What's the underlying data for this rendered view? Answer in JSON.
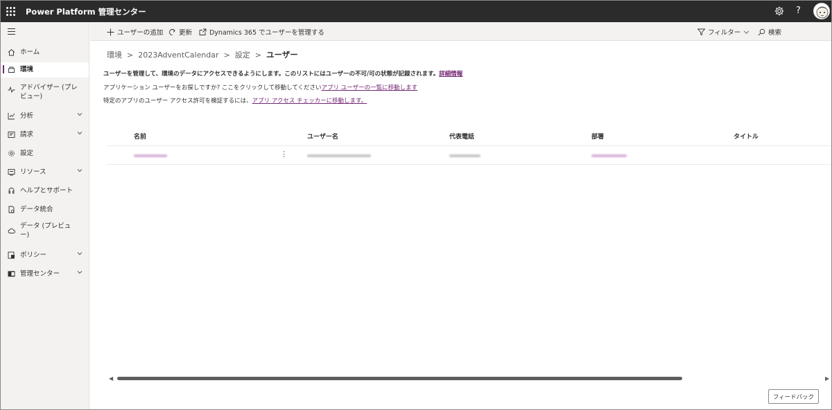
{
  "app": {
    "title": "Power Platform 管理センター"
  },
  "topbar": {
    "settings_icon": "gear-icon",
    "help_label": "?",
    "avatar_icon": "avatar"
  },
  "sidebar": {
    "items": [
      {
        "label": "ホーム",
        "icon": "home-icon",
        "chevron": false,
        "active": false
      },
      {
        "label": "環境",
        "icon": "environment-icon",
        "chevron": false,
        "active": true
      },
      {
        "label": "アドバイザー (プレビュー)",
        "icon": "advisor-icon",
        "chevron": false,
        "active": false
      },
      {
        "label": "分析",
        "icon": "analytics-icon",
        "chevron": true,
        "active": false
      },
      {
        "label": "請求",
        "icon": "billing-icon",
        "chevron": true,
        "active": false
      },
      {
        "label": "設定",
        "icon": "settings-icon",
        "chevron": false,
        "active": false
      },
      {
        "label": "リソース",
        "icon": "resources-icon",
        "chevron": true,
        "active": false
      },
      {
        "label": "ヘルプとサポート",
        "icon": "help-support-icon",
        "chevron": false,
        "active": false
      },
      {
        "label": "データ統合",
        "icon": "data-integration-icon",
        "chevron": false,
        "active": false
      },
      {
        "label": "データ (プレビュー)",
        "icon": "data-preview-icon",
        "chevron": false,
        "active": false
      },
      {
        "label": "ポリシー",
        "icon": "policy-icon",
        "chevron": true,
        "active": false
      },
      {
        "label": "管理センター",
        "icon": "admin-center-icon",
        "chevron": true,
        "active": false
      }
    ]
  },
  "toolbar": {
    "add_user": "ユーザーの追加",
    "refresh": "更新",
    "manage_in_dynamics": "Dynamics 365 でユーザーを管理する",
    "filter": "フィルター",
    "search": "検索"
  },
  "breadcrumb": {
    "environments": "環境",
    "environment_name": "2023AdventCalendar",
    "settings": "設定",
    "current": "ユーザー"
  },
  "info": {
    "line1_text": "ユーザーを管理して、環境のデータにアクセスできるようにします。このリストにはユーザーの不可/可の状態が記録されます。",
    "line1_link": "詳細情報",
    "line2_text": "アプリケーション ユーザーをお探しですか? ここをクリックして移動してください",
    "line2_link": "アプリ ユーザーの一覧に移動します",
    "line3_text": "特定のアプリのユーザー アクセス許可を検証するには、",
    "line3_link": "アプリ アクセス チェッカーに移動します。"
  },
  "table": {
    "columns": [
      "名前",
      "ユーザー名",
      "代表電話",
      "部署",
      "タイトル"
    ],
    "rows_count_note": "",
    "row_more_label": "⋮"
  },
  "footer": {
    "feedback": "フィードバック"
  },
  "colors": {
    "accent": "#742774",
    "topbar": "#2b2b2b",
    "sidebar": "#f3f2f1"
  }
}
